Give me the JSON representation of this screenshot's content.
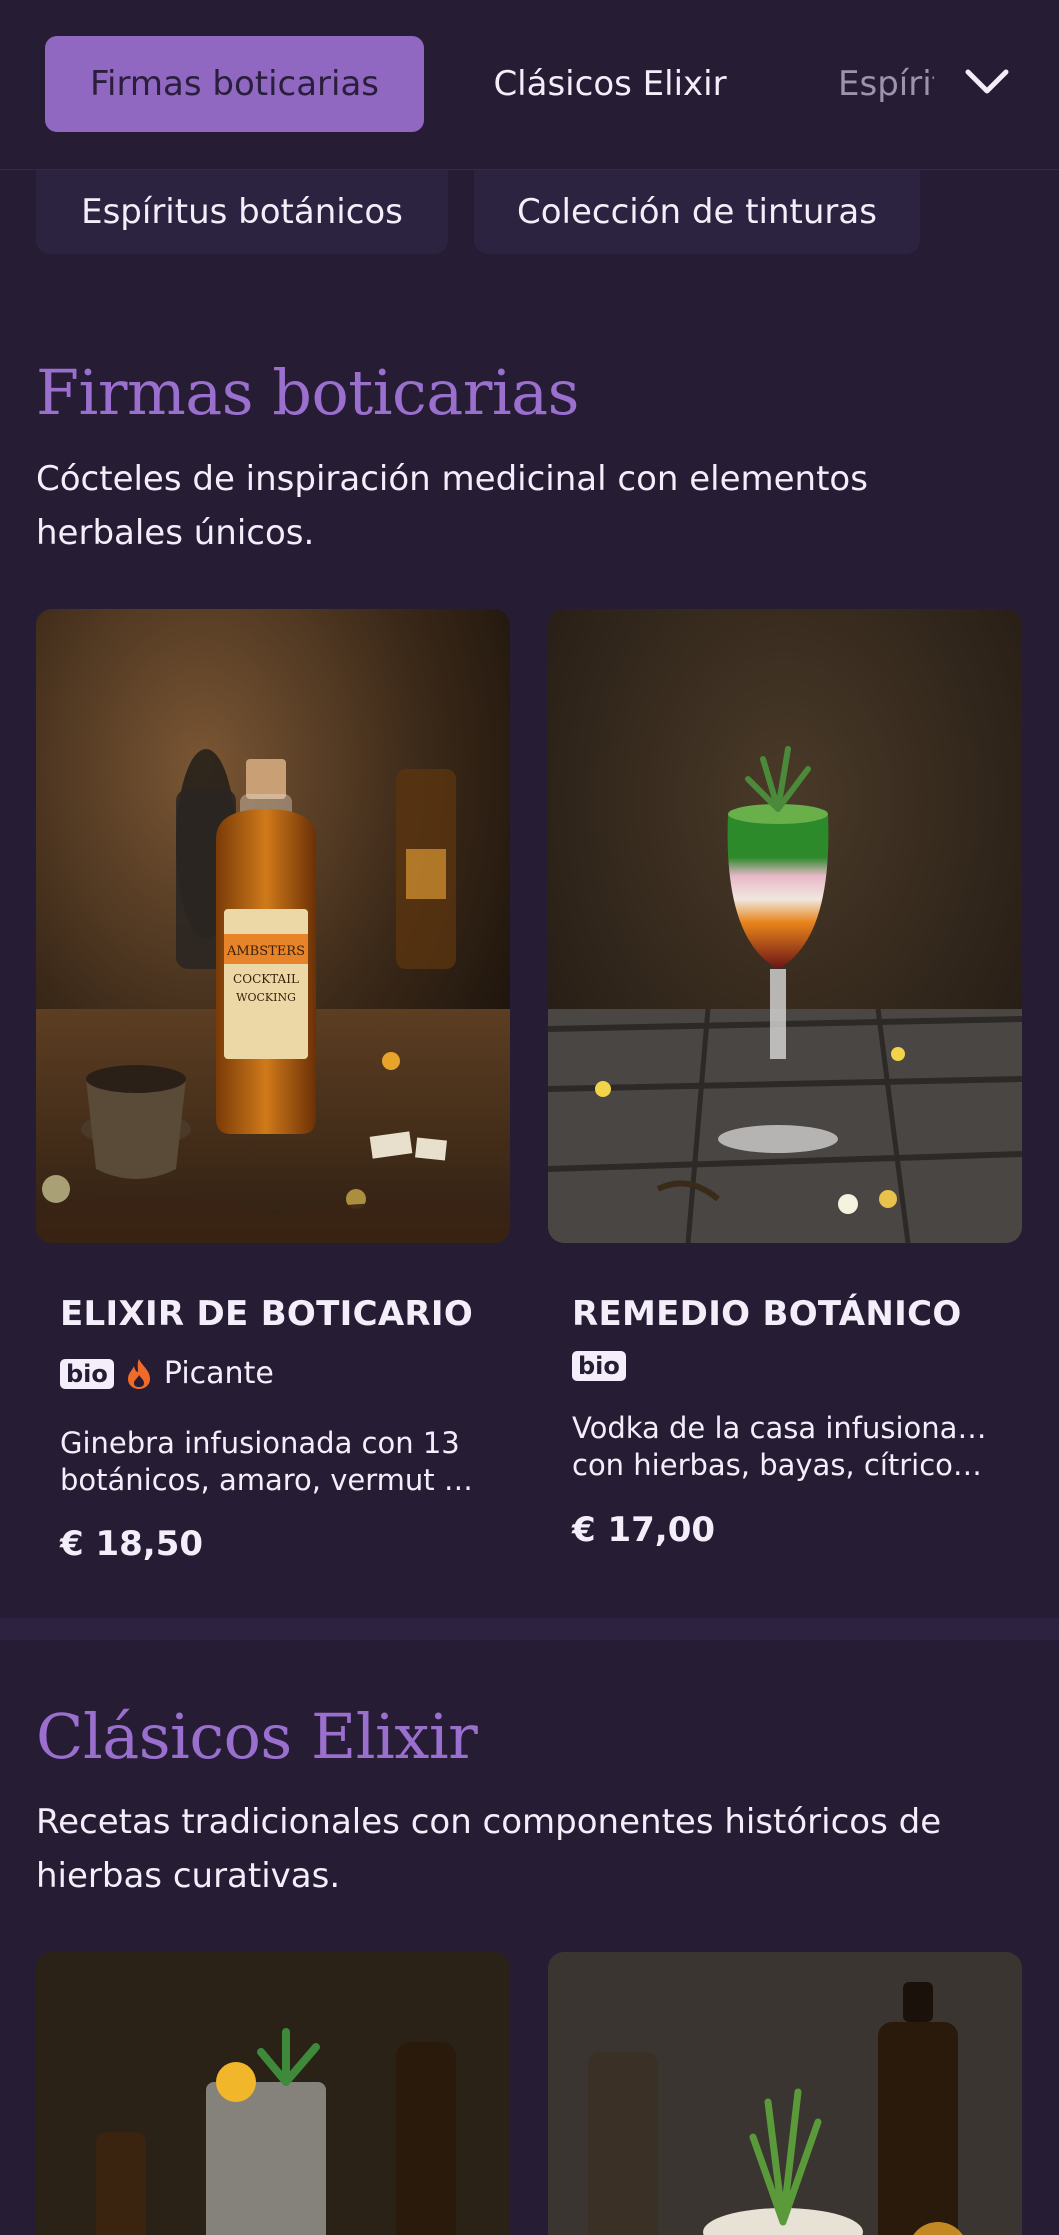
{
  "nav": {
    "tabs": [
      {
        "label": "Firmas boticarias",
        "active": true
      },
      {
        "label": "Clásicos Elixir",
        "active": false
      },
      {
        "label": "Espíritus botánicos",
        "active": false
      }
    ],
    "chevron_icon": "chevron-down-icon"
  },
  "subnav": {
    "items": [
      {
        "label": "Espíritus botánicos"
      },
      {
        "label": "Colección de tinturas"
      }
    ]
  },
  "sections": [
    {
      "title": "Firmas boticarias",
      "description": "Cócteles de inspiración medicinal con elementos herbales únicos.",
      "description_lines": [
        "Cócteles de inspiración medicinal con elementos",
        "herbales únicos."
      ],
      "items": [
        {
          "name": "ELIXIR DE BOTICARIO",
          "badge": "bio",
          "spicy_icon": "flame-icon",
          "spicy_label": "Picante",
          "desc_lines": [
            "Ginebra infusionada con 13",
            "botánicos, amaro, vermut y..."
          ],
          "price": "€ 18,50"
        },
        {
          "name": "REMEDIO BOTÁNICO",
          "badge": "bio",
          "desc_lines": [
            "Vodka de la casa infusionado",
            "con hierbas, bayas, cítricos ..."
          ],
          "price": "€ 17,00"
        }
      ]
    },
    {
      "title": "Clásicos Elixir",
      "description": "Recetas tradicionales con componentes históricos de hierbas curativas.",
      "description_lines": [
        "Recetas tradicionales con componentes históricos de",
        "hierbas curativas."
      ]
    }
  ],
  "colors": {
    "background": "#261d35",
    "accent": "#9068c2",
    "title_accent": "#9a6fce",
    "flame": "#f06a2a"
  }
}
